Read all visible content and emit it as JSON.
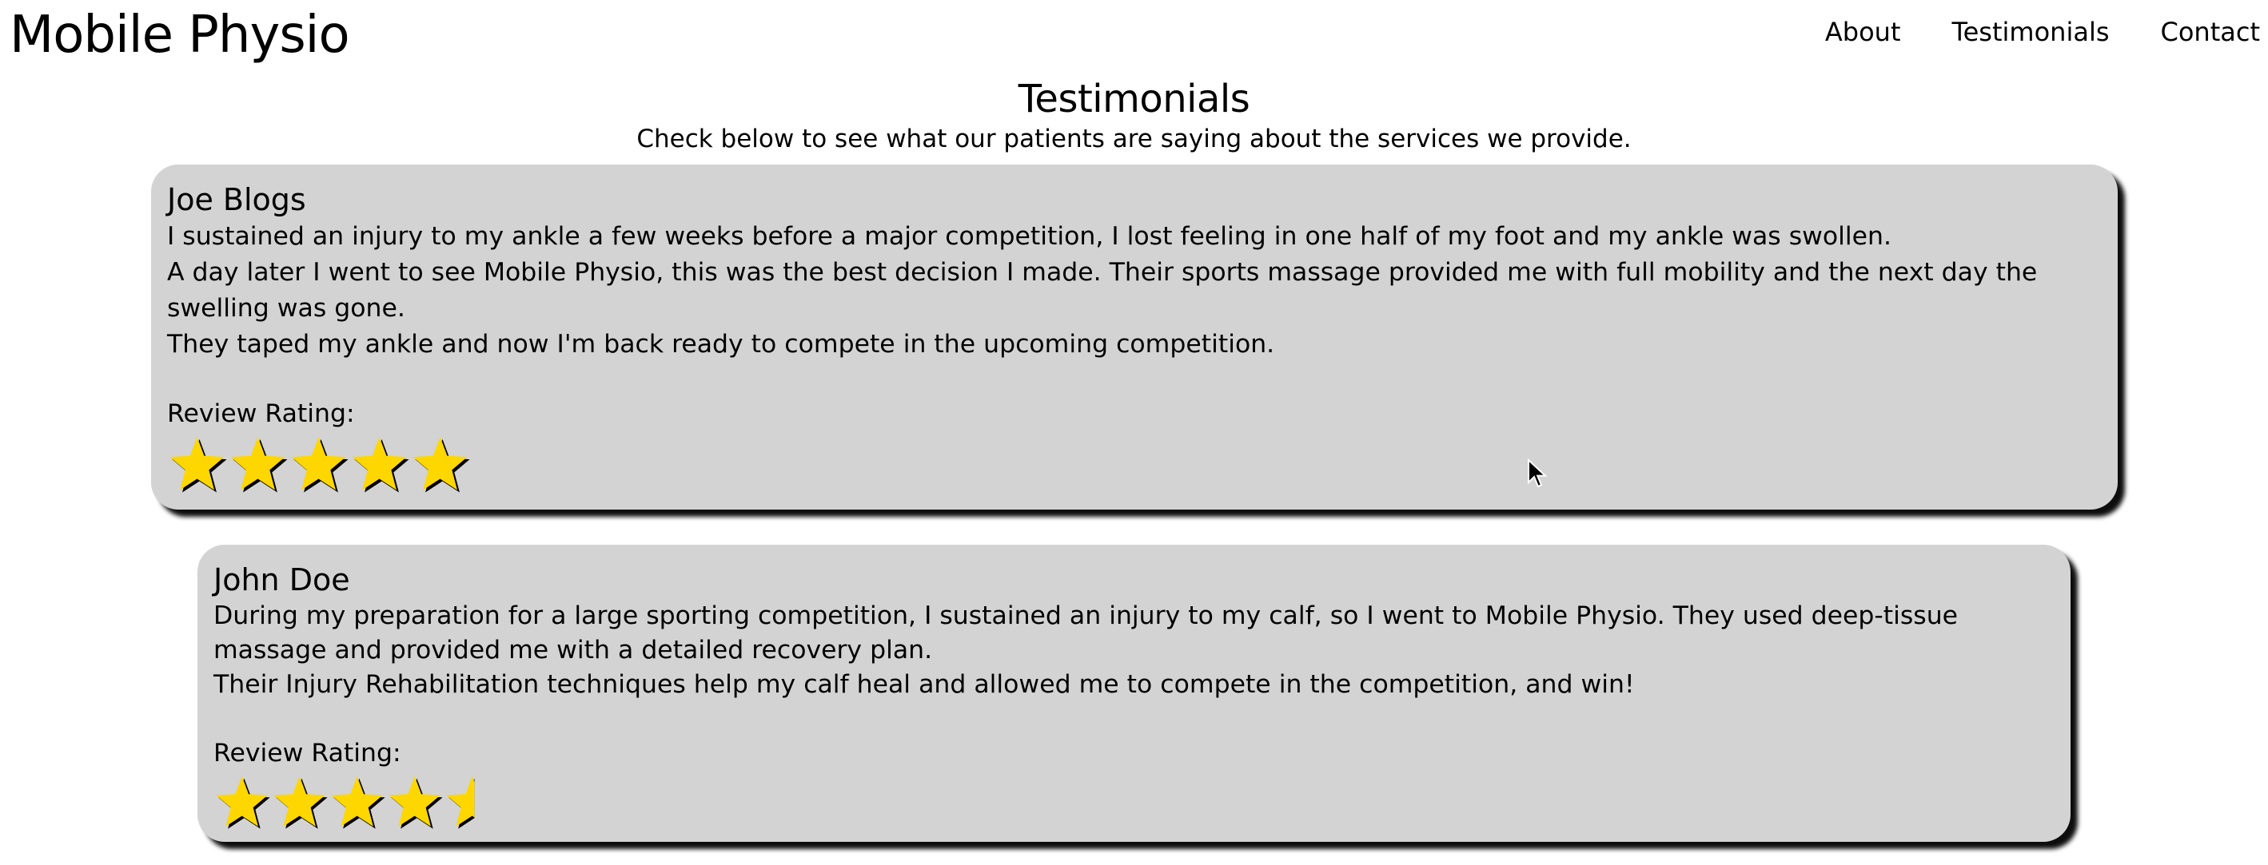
{
  "header": {
    "site_title": "Mobile Physio",
    "nav": [
      {
        "label": "About"
      },
      {
        "label": "Testimonials"
      },
      {
        "label": "Contact"
      }
    ]
  },
  "section": {
    "title": "Testimonials",
    "subtitle": "Check below to see what our patients are saying about the services we provide."
  },
  "testimonials": [
    {
      "name": "Joe Blogs",
      "lines": [
        "I sustained an injury to my ankle a few weeks before a major competition, I lost feeling in one half of my foot and my ankle was swollen.",
        "A day later I went to see Mobile Physio, this was the best decision I made. Their sports massage provided me with full mobility and the next day the swelling was gone.",
        "They taped my ankle and now I'm back ready to compete in the upcoming competition."
      ],
      "rating_label": "Review Rating:",
      "rating": 5,
      "rating_max": 5
    },
    {
      "name": "John Doe",
      "lines": [
        "During my preparation for a large sporting competition, I sustained an injury to my calf, so I went to Mobile Physio. They used deep-tissue massage and provided me with a detailed recovery plan.",
        "Their Injury Rehabilitation techniques help my calf heal and allowed me to compete in the competition, and win!"
      ],
      "rating_label": "Review Rating:",
      "rating": 4.5,
      "rating_max": 5
    }
  ],
  "colors": {
    "card_background": "#d3d3d3",
    "star_fill": "#ffd700",
    "star_shadow": "#000000",
    "page_background": "#ffffff"
  },
  "icons": {
    "star": "star-icon",
    "half_star": "half-star-icon",
    "cursor": "mouse-pointer-icon"
  }
}
